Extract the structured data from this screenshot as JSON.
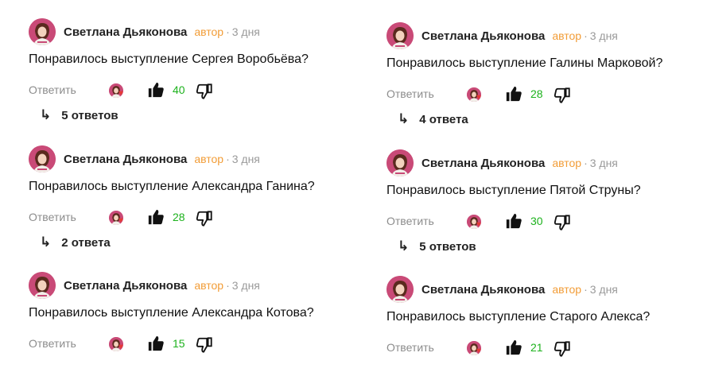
{
  "colors": {
    "badge": "#f29d38",
    "likes": "#1db21d",
    "muted": "#8c8c8c",
    "avatar": "#c94a77"
  },
  "comments": [
    {
      "author": "Светлана Дьяконова",
      "badge": "автор",
      "separator": "·",
      "ago": "3 дня",
      "text": "Понравилось выступление Сергея Воробьёва?",
      "reply_label": "Ответить",
      "likes": "40",
      "replies": "5 ответов"
    },
    {
      "author": "Светлана Дьяконова",
      "badge": "автор",
      "separator": "·",
      "ago": "3 дня",
      "text": "Понравилось выступление Александра Ганина?",
      "reply_label": "Ответить",
      "likes": "28",
      "replies": "2 ответа"
    },
    {
      "author": "Светлана Дьяконова",
      "badge": "автор",
      "separator": "·",
      "ago": "3 дня",
      "text": "Понравилось выступление Александра Котова?",
      "reply_label": "Ответить",
      "likes": "15"
    },
    {
      "author": "Светлана Дьяконова",
      "badge": "автор",
      "separator": "·",
      "ago": "3 дня",
      "text": "Понравилось выступление Галины Марковой?",
      "reply_label": "Ответить",
      "likes": "28",
      "replies": "4 ответа"
    },
    {
      "author": "Светлана Дьяконова",
      "badge": "автор",
      "separator": "·",
      "ago": "3 дня",
      "text": "Понравилось выступление Пятой Струны?",
      "reply_label": "Ответить",
      "likes": "30",
      "replies": "5 ответов"
    },
    {
      "author": "Светлана Дьяконова",
      "badge": "автор",
      "separator": "·",
      "ago": "3 дня",
      "text": "Понравилось выступление Старого Алекса?",
      "reply_label": "Ответить",
      "likes": "21"
    }
  ]
}
